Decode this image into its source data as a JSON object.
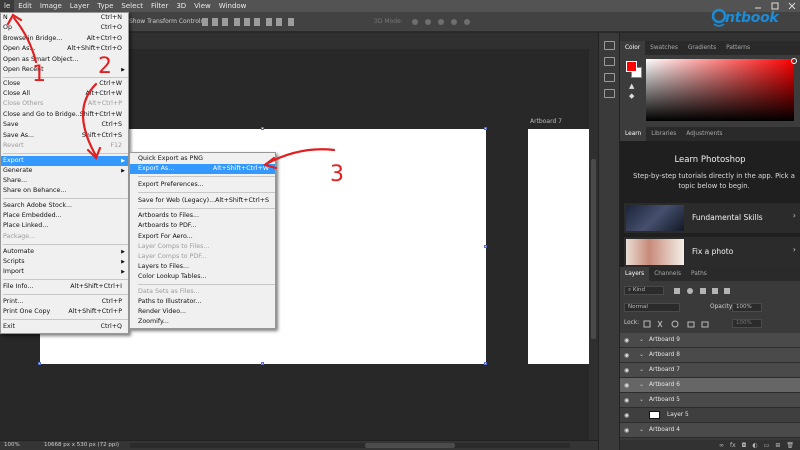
{
  "menubar": {
    "items": [
      "le",
      "Edit",
      "Image",
      "Layer",
      "Type",
      "Select",
      "Filter",
      "3D",
      "View",
      "Window"
    ]
  },
  "optbar": {
    "transform_label": "Show Transform Controls",
    "mode_label": "3D Mode:"
  },
  "canvas": {
    "artboard7_label": "Artboard 7"
  },
  "status": {
    "zoom": "100%",
    "doc_info": "10668 px x 530 px (72 ppi)"
  },
  "file_menu": {
    "items": [
      {
        "label": "N",
        "shortcut": "Ctrl+N"
      },
      {
        "label": "Op",
        "shortcut": "Ctrl+O"
      },
      {
        "label": "Browse in Bridge...",
        "shortcut": "Alt+Ctrl+O"
      },
      {
        "label": "Open As...",
        "shortcut": "Alt+Shift+Ctrl+O"
      },
      {
        "label": "Open as Smart Object...",
        "shortcut": ""
      },
      {
        "label": "Open Recent",
        "shortcut": ""
      },
      {
        "label": "Close",
        "shortcut": "Ctrl+W"
      },
      {
        "label": "Close All",
        "shortcut": "Alt+Ctrl+W"
      },
      {
        "label": "Close Others",
        "shortcut": "Alt+Ctrl+P"
      },
      {
        "label": "Close and Go to Bridge...",
        "shortcut": "Shift+Ctrl+W"
      },
      {
        "label": "Save",
        "shortcut": "Ctrl+S"
      },
      {
        "label": "Save As...",
        "shortcut": "Shift+Ctrl+S"
      },
      {
        "label": "Revert",
        "shortcut": "F12"
      },
      {
        "label": "Export",
        "shortcut": ""
      },
      {
        "label": "Generate",
        "shortcut": ""
      },
      {
        "label": "Share...",
        "shortcut": ""
      },
      {
        "label": "Share on Behance...",
        "shortcut": ""
      },
      {
        "label": "Search Adobe Stock...",
        "shortcut": ""
      },
      {
        "label": "Place Embedded...",
        "shortcut": ""
      },
      {
        "label": "Place Linked...",
        "shortcut": ""
      },
      {
        "label": "Package...",
        "shortcut": ""
      },
      {
        "label": "Automate",
        "shortcut": ""
      },
      {
        "label": "Scripts",
        "shortcut": ""
      },
      {
        "label": "Import",
        "shortcut": ""
      },
      {
        "label": "File Info...",
        "shortcut": "Alt+Shift+Ctrl+I"
      },
      {
        "label": "Print...",
        "shortcut": "Ctrl+P"
      },
      {
        "label": "Print One Copy",
        "shortcut": "Alt+Shift+Ctrl+P"
      },
      {
        "label": "Exit",
        "shortcut": "Ctrl+Q"
      }
    ]
  },
  "export_menu": {
    "items": [
      {
        "label": "Quick Export as PNG",
        "shortcut": ""
      },
      {
        "label": "Export As...",
        "shortcut": "Alt+Shift+Ctrl+W"
      },
      {
        "label": "Export Preferences...",
        "shortcut": ""
      },
      {
        "label": "Save for Web (Legacy)...",
        "shortcut": "Alt+Shift+Ctrl+S"
      },
      {
        "label": "Artboards to Files...",
        "shortcut": ""
      },
      {
        "label": "Artboards to PDF...",
        "shortcut": ""
      },
      {
        "label": "Export For Aero...",
        "shortcut": ""
      },
      {
        "label": "Layer Comps to Files...",
        "shortcut": ""
      },
      {
        "label": "Layer Comps to PDF...",
        "shortcut": ""
      },
      {
        "label": "Layers to Files...",
        "shortcut": ""
      },
      {
        "label": "Color Lookup Tables...",
        "shortcut": ""
      },
      {
        "label": "Data Sets as Files...",
        "shortcut": ""
      },
      {
        "label": "Paths to Illustrator...",
        "shortcut": ""
      },
      {
        "label": "Render Video...",
        "shortcut": ""
      },
      {
        "label": "Zoomify...",
        "shortcut": ""
      }
    ]
  },
  "color_panel": {
    "tabs": [
      "Color",
      "Swatches",
      "Gradients",
      "Patterns"
    ],
    "foreground": "#ff0000",
    "background": "#ffffff"
  },
  "learn_panel": {
    "tabs": [
      "Learn",
      "Libraries",
      "Adjustments"
    ],
    "title": "Learn Photoshop",
    "description": "Step-by-step tutorials directly in the app. Pick a topic below to begin.",
    "cards": [
      {
        "label": "Fundamental Skills"
      },
      {
        "label": "Fix a photo"
      }
    ]
  },
  "layers_panel": {
    "tabs": [
      "Layers",
      "Channels",
      "Paths"
    ],
    "kind_label": "Kind",
    "blend_mode": "Normal",
    "opacity_label": "Opacity:",
    "opacity_value": "100%",
    "lock_label": "Lock:",
    "fill_value": "100%",
    "layers": [
      {
        "name": "Artboard 9",
        "selected": false
      },
      {
        "name": "Artboard 8",
        "selected": false
      },
      {
        "name": "Artboard 7",
        "selected": false
      },
      {
        "name": "Artboard 6",
        "selected": true
      },
      {
        "name": "Artboard 5",
        "selected": false
      },
      {
        "name": "Layer 5",
        "selected": false
      },
      {
        "name": "Artboard 4",
        "selected": false
      }
    ]
  },
  "logo": {
    "text": "ntbook"
  },
  "annotations": {
    "num1": "1",
    "num2": "2",
    "num3": "3"
  },
  "colors": {
    "menu_highlight": "#3399ff",
    "annotation_red": "#e02020",
    "logo_blue": "#1a8cd8"
  }
}
